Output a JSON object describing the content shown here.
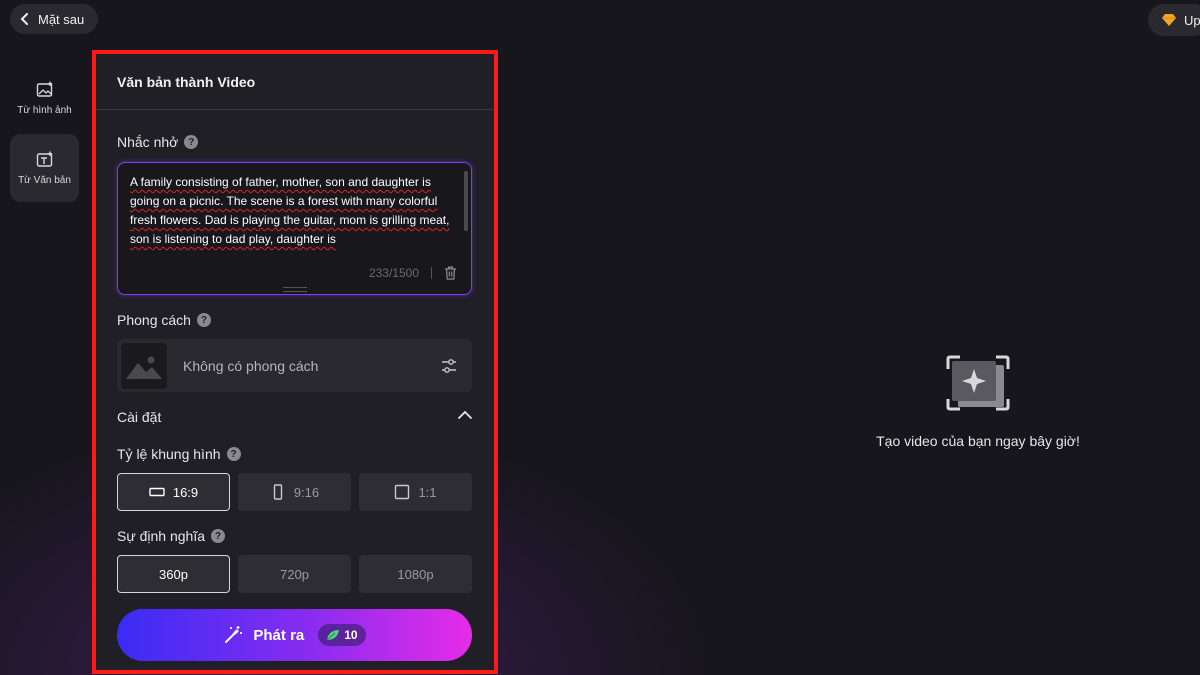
{
  "top": {
    "back_label": "Mặt sau",
    "upgrade_label": "Up",
    "upgrade_icon": "diamond-icon"
  },
  "sidebar": {
    "items": [
      {
        "label": "Từ hình ảnh",
        "icon": "image-plus-icon",
        "active": false
      },
      {
        "label": "Từ Văn bản",
        "icon": "text-plus-icon",
        "active": true
      }
    ]
  },
  "panel": {
    "title": "Văn bản thành Video",
    "prompt": {
      "label": "Nhắc nhở",
      "text": "A family consisting of father, mother, son and daughter is going on a picnic. The scene is a forest with many colorful fresh flowers. Dad is playing the guitar, mom is grilling meat, son is listening to dad play, daughter is",
      "counter": "233/1500"
    },
    "style": {
      "label": "Phong cách",
      "value": "Không có phong cách"
    },
    "settings": {
      "label": "Cài đặt",
      "aspect": {
        "label": "Tỷ lệ khung hình",
        "options": [
          "16:9",
          "9:16",
          "1:1"
        ],
        "selected": "16:9"
      },
      "definition": {
        "label": "Sự định nghĩa",
        "options": [
          "360p",
          "720p",
          "1080p"
        ],
        "selected": "360p"
      }
    },
    "generate": {
      "label": "Phát ra",
      "credits": "10"
    }
  },
  "preview": {
    "message": "Tạo video của bạn ngay bây giờ!"
  },
  "colors": {
    "accent_start": "#3a2cf5",
    "accent_end": "#e72ce8",
    "highlight": "#ff1a1a",
    "prompt_border": "#7b3ff2"
  }
}
